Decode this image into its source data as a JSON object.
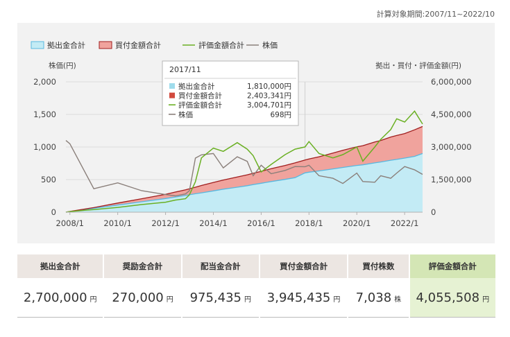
{
  "period_label": "計算対象期間:2007/11~2022/10",
  "legend": [
    {
      "label": "拠出金合計",
      "color": "#c3ebf5",
      "border": "#58b8e0",
      "kind": "box"
    },
    {
      "label": "買付金額合計",
      "color": "#f0a39d",
      "border": "#a01e1e",
      "kind": "box"
    },
    {
      "label": "評価金額合計",
      "color": "#6ab023",
      "kind": "line"
    },
    {
      "label": "株価",
      "color": "#8a7f7a",
      "kind": "line"
    }
  ],
  "tooltip": {
    "title": "2017/11",
    "rows": [
      {
        "label": "拠出金合計",
        "value": "1,810,000円",
        "color": "#9fdcec"
      },
      {
        "label": "買付金額合計",
        "value": "2,403,341円",
        "color": "#d24a3e"
      },
      {
        "label": "評価金額合計",
        "value": "3,004,701円",
        "color": "#6ab023"
      },
      {
        "label": "株価",
        "value": "698円",
        "color": "#8a7f7a"
      }
    ]
  },
  "chart_data": {
    "type": "area",
    "x": [
      "2007/11",
      "2008/1",
      "2009/1",
      "2010/1",
      "2011/1",
      "2012/1",
      "2012/6",
      "2012/11",
      "2013/1",
      "2013/4",
      "2013/7",
      "2014/1",
      "2014/6",
      "2015/1",
      "2015/6",
      "2015/9",
      "2016/1",
      "2016/6",
      "2017/1",
      "2017/6",
      "2017/11",
      "2018/1",
      "2018/6",
      "2019/1",
      "2019/6",
      "2020/1",
      "2020/4",
      "2020/10",
      "2021/1",
      "2021/6",
      "2021/9",
      "2022/1",
      "2022/6",
      "2022/10"
    ],
    "left_axis": {
      "label": "株価(円)",
      "ticks": [
        "0",
        "500",
        "1,000",
        "1,500",
        "2,000"
      ],
      "range": [
        0,
        2000
      ]
    },
    "right_axis": {
      "label": "拠出・買付・評価金額(円)",
      "ticks": [
        "0",
        "1,500,000",
        "3,000,000",
        "4,500,000",
        "6,000,000"
      ],
      "range": [
        0,
        6000000
      ]
    },
    "x_ticks": [
      "2008/1",
      "2010/1",
      "2012/1",
      "2014/1",
      "2016/1",
      "2018/1",
      "2020/1",
      "2022/1"
    ],
    "series": [
      {
        "name": "拠出金合計",
        "axis": "right",
        "values": [
          0,
          30000,
          180000,
          330000,
          480000,
          630000,
          700000,
          770000,
          800000,
          850000,
          890000,
          980000,
          1060000,
          1150000,
          1220000,
          1270000,
          1330000,
          1410000,
          1510000,
          1590000,
          1810000,
          1840000,
          1900000,
          1990000,
          2060000,
          2150000,
          2180000,
          2270000,
          2310000,
          2390000,
          2430000,
          2490000,
          2570000,
          2700000
        ]
      },
      {
        "name": "買付金額合計",
        "axis": "right",
        "values": [
          0,
          35000,
          210000,
          420000,
          620000,
          820000,
          930000,
          1030000,
          1080000,
          1150000,
          1230000,
          1370000,
          1480000,
          1620000,
          1720000,
          1790000,
          1880000,
          2000000,
          2150000,
          2270000,
          2403341,
          2450000,
          2550000,
          2720000,
          2850000,
          3010000,
          3060000,
          3230000,
          3300000,
          3460000,
          3530000,
          3620000,
          3790000,
          3945435
        ]
      },
      {
        "name": "評価金額合計",
        "axis": "right",
        "values": [
          0,
          30000,
          120000,
          220000,
          350000,
          460000,
          560000,
          620000,
          800000,
          1400000,
          2500000,
          2950000,
          2800000,
          3200000,
          2900000,
          2600000,
          1850000,
          2200000,
          2650000,
          2900000,
          3004701,
          3250000,
          2700000,
          2500000,
          2650000,
          3000000,
          2350000,
          3000000,
          3350000,
          3800000,
          4300000,
          4150000,
          4650000,
          4055508
        ]
      },
      {
        "name": "株価",
        "axis": "left",
        "values": [
          1100,
          1050,
          360,
          450,
          330,
          270,
          250,
          280,
          330,
          830,
          880,
          900,
          680,
          850,
          780,
          560,
          720,
          590,
          640,
          700,
          698,
          720,
          560,
          520,
          440,
          600,
          470,
          460,
          560,
          520,
          600,
          700,
          650,
          580
        ]
      }
    ]
  },
  "summary": {
    "headers": [
      "拠出金合計",
      "奨励金合計",
      "配当金合計",
      "買付金額合計",
      "買付株数",
      "評価金額合計"
    ],
    "values": [
      "2,700,000",
      "270,000",
      "975,435",
      "3,945,435",
      "7,038",
      "4,055,508"
    ],
    "units": [
      "円",
      "円",
      "円",
      "円",
      "株",
      "円"
    ],
    "highlight_color": "#d4e6b5"
  }
}
